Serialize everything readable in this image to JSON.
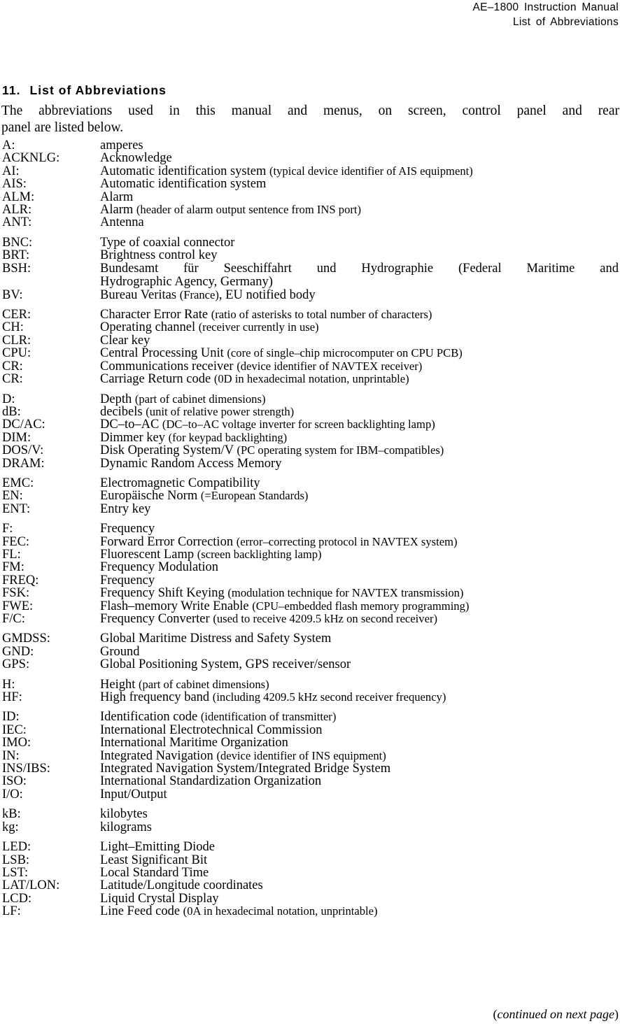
{
  "header": {
    "line1": "AE–1800  Instruction  Manual",
    "line2": "List  of  Abbreviations"
  },
  "section": {
    "number": "11.",
    "title": "List of Abbreviations"
  },
  "intro": {
    "line1": "The abbreviations used in this manual and menus, on screen, control panel and rear",
    "line2": "panel are listed below."
  },
  "groups": [
    {
      "letter": "A",
      "entries": [
        {
          "term": "A:",
          "definition": "amperes"
        },
        {
          "term": "ACKNLG:",
          "definition": "Acknowledge"
        },
        {
          "term": "AI:",
          "definition": "Automatic identification system ",
          "paren": "(typical device identifier of AIS equipment)"
        },
        {
          "term": "AIS:",
          "definition": "Automatic identification system"
        },
        {
          "term": "ALM:",
          "definition": "Alarm"
        },
        {
          "term": "ALR:",
          "definition": "Alarm ",
          "paren": "(header of alarm output sentence from INS port)"
        },
        {
          "term": "ANT:",
          "definition": "Antenna"
        }
      ]
    },
    {
      "letter": "B",
      "entries": [
        {
          "term": "BNC:",
          "definition": "Type of coaxial connector"
        },
        {
          "term": "BRT:",
          "definition": "Brightness control key"
        },
        {
          "term": "BSH:",
          "definition": "Bundesamt für Seeschiffahrt und Hydrographie ",
          "paren": "(Federal Maritime and Hydrographic Agency, Germany)",
          "wrapped": true,
          "line1": "Bundesamt für Seeschiffahrt und Hydrographie (Federal Maritime and",
          "line2": "Hydrographic Agency, Germany)"
        },
        {
          "term": "BV:",
          "definition": "Bureau Veritas ",
          "paren": "(France)",
          "definition_tail": ", EU notified body"
        }
      ]
    },
    {
      "letter": "C",
      "entries": [
        {
          "term": "CER:",
          "definition": "Character Error Rate ",
          "paren": "(ratio of asterisks to total number of characters)"
        },
        {
          "term": "CH:",
          "definition": "Operating channel ",
          "paren": "(receiver currently in use)"
        },
        {
          "term": "CLR:",
          "definition": "Clear key"
        },
        {
          "term": "CPU:",
          "definition": "Central Processing Unit ",
          "paren": "(core of single–chip microcomputer on CPU PCB)"
        },
        {
          "term": "CR:",
          "definition": "Communications receiver ",
          "paren": "(device identifier of NAVTEX receiver)"
        },
        {
          "term": "CR:",
          "definition": "Carriage Return code ",
          "paren": "(0D in hexadecimal notation, unprintable)"
        }
      ]
    },
    {
      "letter": "D",
      "entries": [
        {
          "term": "D:",
          "definition": "Depth ",
          "paren": "(part of cabinet dimensions)"
        },
        {
          "term": "dB:",
          "definition": "decibels ",
          "paren": "(unit of relative power strength)"
        },
        {
          "term": "DC/AC:",
          "definition": "DC–to–AC ",
          "paren": "(DC–to–AC voltage inverter for screen backlighting lamp)"
        },
        {
          "term": "DIM:",
          "definition": "Dimmer key ",
          "paren": "(for keypad backlighting)"
        },
        {
          "term": "DOS/V:",
          "definition": "Disk Operating System/V ",
          "paren": "(PC operating system for IBM–compatibles)"
        },
        {
          "term": "DRAM:",
          "definition": "Dynamic Random Access Memory"
        }
      ]
    },
    {
      "letter": "E",
      "entries": [
        {
          "term": "EMC:",
          "definition": "Electromagnetic Compatibility"
        },
        {
          "term": "EN:",
          "definition": "Europäische Norm ",
          "paren": "(=European Standards)"
        },
        {
          "term": "ENT:",
          "definition": "Entry key"
        }
      ]
    },
    {
      "letter": "F",
      "entries": [
        {
          "term": "F:",
          "definition": "Frequency"
        },
        {
          "term": "FEC:",
          "definition": "Forward Error Correction ",
          "paren": "(error–correcting protocol in NAVTEX system)"
        },
        {
          "term": "FL:",
          "definition": "Fluorescent Lamp ",
          "paren": "(screen backlighting lamp)"
        },
        {
          "term": "FM:",
          "definition": "Frequency Modulation"
        },
        {
          "term": "FREQ:",
          "definition": "Frequency"
        },
        {
          "term": "FSK:",
          "definition": "Frequency Shift Keying ",
          "paren": "(modulation technique for NAVTEX transmission)"
        },
        {
          "term": "FWE:",
          "definition": "Flash–memory Write Enable ",
          "paren": "(CPU–embedded flash memory programming)"
        },
        {
          "term": "F/C:",
          "definition": "Frequency Converter ",
          "paren": "(used to receive 4209.5 kHz on second receiver)"
        }
      ]
    },
    {
      "letter": "G",
      "entries": [
        {
          "term": "GMDSS:",
          "definition": "Global Maritime Distress and Safety System"
        },
        {
          "term": "GND:",
          "definition": "Ground"
        },
        {
          "term": "GPS:",
          "definition": "Global Positioning System, GPS receiver/sensor"
        }
      ]
    },
    {
      "letter": "H",
      "entries": [
        {
          "term": "H:",
          "definition": "Height ",
          "paren": "(part of cabinet dimensions)"
        },
        {
          "term": "HF:",
          "definition": "High frequency band ",
          "paren": "(including 4209.5 kHz second receiver frequency)"
        }
      ]
    },
    {
      "letter": "I",
      "entries": [
        {
          "term": "ID:",
          "definition": "Identification code ",
          "paren": "(identification of transmitter)"
        },
        {
          "term": "IEC:",
          "definition": "International Electrotechnical Commission"
        },
        {
          "term": "IMO:",
          "definition": "International Maritime Organization"
        },
        {
          "term": "IN:",
          "definition": "Integrated Navigation ",
          "paren": "(device identifier of INS equipment)"
        },
        {
          "term": "INS/IBS:",
          "definition": "Integrated Navigation System/Integrated Bridge System"
        },
        {
          "term": "ISO:",
          "definition": "International Standardization Organization"
        },
        {
          "term": "I/O:",
          "definition": "Input/Output"
        }
      ]
    },
    {
      "letter": "K",
      "entries": [
        {
          "term": "kB:",
          "definition": "kilobytes"
        },
        {
          "term": "kg:",
          "definition": "kilograms"
        }
      ]
    },
    {
      "letter": "L",
      "entries": [
        {
          "term": "LED:",
          "definition": "Light–Emitting Diode"
        },
        {
          "term": "LSB:",
          "definition": "Least Significant Bit"
        },
        {
          "term": "LST:",
          "definition": "Local Standard Time"
        },
        {
          "term": "LAT/LON:",
          "definition": "Latitude/Longitude coordinates"
        },
        {
          "term": "LCD:",
          "definition": "Liquid Crystal Display"
        },
        {
          "term": "LF:",
          "definition": "Line Feed code ",
          "paren": "(0A in hexadecimal notation, unprintable)"
        }
      ]
    }
  ],
  "footer": {
    "open_paren": "(",
    "text": "continued on next page",
    "close_paren": ")"
  }
}
